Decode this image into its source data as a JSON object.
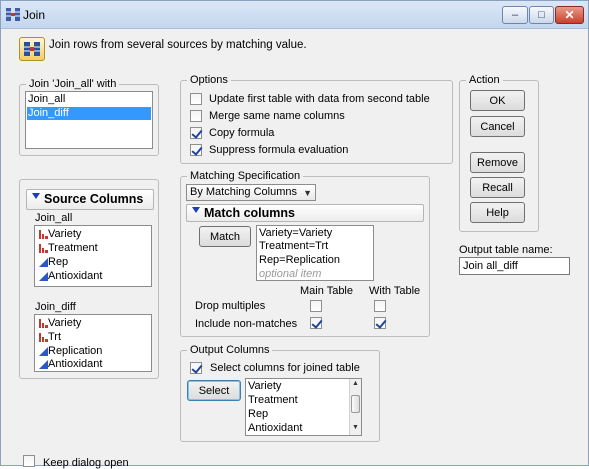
{
  "window": {
    "title": "Join",
    "icon": "join-table-icon",
    "controls": {
      "minimize": "–",
      "maximize": "□",
      "close": "✕"
    }
  },
  "header": {
    "text": "Join rows from several sources by matching value."
  },
  "join_with": {
    "legend": "Join 'Join_all' with",
    "items": [
      "Join_all",
      "Join_diff"
    ],
    "selected": "Join_diff"
  },
  "source_columns": {
    "title": "Source Columns",
    "tables": [
      {
        "name": "Join_all",
        "columns": [
          {
            "label": "Variety",
            "type": "nominal"
          },
          {
            "label": "Treatment",
            "type": "nominal"
          },
          {
            "label": "Rep",
            "type": "continuous"
          },
          {
            "label": "Antioxidant",
            "type": "continuous"
          }
        ]
      },
      {
        "name": "Join_diff",
        "columns": [
          {
            "label": "Variety",
            "type": "nominal"
          },
          {
            "label": "Trt",
            "type": "nominal"
          },
          {
            "label": "Replication",
            "type": "continuous"
          },
          {
            "label": "Antioxidant",
            "type": "continuous"
          }
        ]
      }
    ]
  },
  "options": {
    "legend": "Options",
    "items": [
      {
        "label": "Update first table with data from second table",
        "checked": false
      },
      {
        "label": "Merge same name columns",
        "checked": false
      },
      {
        "label": "Copy formula",
        "checked": true
      },
      {
        "label": "Suppress formula evaluation",
        "checked": true
      }
    ]
  },
  "matching": {
    "legend": "Matching Specification",
    "method": "By Matching Columns",
    "match_title": "Match columns",
    "match_button": "Match",
    "pairs": [
      "Variety=Variety",
      "Treatment=Trt",
      "Rep=Replication"
    ],
    "placeholder": "optional item",
    "col_main": "Main Table",
    "col_with": "With Table",
    "drop_multiples": {
      "label": "Drop multiples",
      "main": false,
      "with": false
    },
    "include_nonmatches": {
      "label": "Include non-matches",
      "main": true,
      "with": true
    }
  },
  "output_columns": {
    "legend": "Output Columns",
    "select_label": "Select columns for joined table",
    "select_checked": true,
    "select_button": "Select",
    "items": [
      "Variety",
      "Treatment",
      "Rep",
      "Antioxidant"
    ]
  },
  "action": {
    "legend": "Action",
    "ok": "OK",
    "cancel": "Cancel",
    "remove": "Remove",
    "recall": "Recall",
    "help": "Help"
  },
  "output_table": {
    "label": "Output table name:",
    "value": "Join all_diff"
  },
  "keep_open": {
    "label": "Keep dialog open",
    "checked": false
  },
  "colors": {
    "selection": "#3399ff",
    "nominal_icon": "#c0392b",
    "continuous_icon": "#2b57c7",
    "disclosure": "#1a3fb8"
  }
}
